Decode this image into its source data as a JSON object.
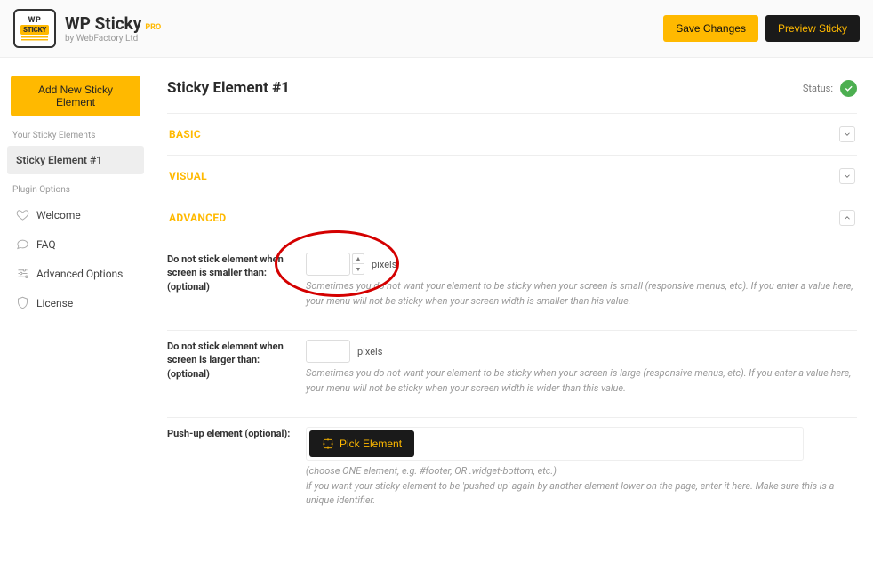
{
  "header": {
    "logo_wp": "WP",
    "logo_sticky": "STICKY",
    "title": "WP Sticky",
    "pro": "PRO",
    "subtitle": "by WebFactory Ltd",
    "save_btn": "Save Changes",
    "preview_btn": "Preview Sticky"
  },
  "sidebar": {
    "add_btn": "Add New Sticky Element",
    "elements_head": "Your Sticky Elements",
    "elements": [
      {
        "label": "Sticky Element #1"
      }
    ],
    "options_head": "Plugin Options",
    "options": [
      {
        "label": "Welcome"
      },
      {
        "label": "FAQ"
      },
      {
        "label": "Advanced Options"
      },
      {
        "label": "License"
      }
    ]
  },
  "main": {
    "title": "Sticky Element #1",
    "status_label": "Status:",
    "sections": {
      "basic": "BASIC",
      "visual": "VISUAL",
      "advanced": "ADVANCED"
    },
    "fields": {
      "smaller": {
        "label": "Do not stick element when screen is smaller than: (optional)",
        "value": "",
        "unit": "pixels",
        "help": "Sometimes you do not want your element to be sticky when your screen is small (responsive menus, etc). If you enter a value here, your menu will not be sticky when your screen width is smaller than his value."
      },
      "larger": {
        "label": "Do not stick element when screen is larger than: (optional)",
        "value": "",
        "unit": "pixels",
        "help": "Sometimes you do not want your element to be sticky when your screen is large (responsive menus, etc). If you enter a value here, your menu will not be sticky when your screen width is wider than this value."
      },
      "pushup": {
        "label": "Push-up element (optional):",
        "btn": "Pick Element",
        "help1": "(choose ONE element, e.g. #footer, OR .widget-bottom, etc.)",
        "help2": "If you want your sticky element to be 'pushed up' again by another element lower on the page, enter it here. Make sure this is a unique identifier."
      }
    }
  }
}
